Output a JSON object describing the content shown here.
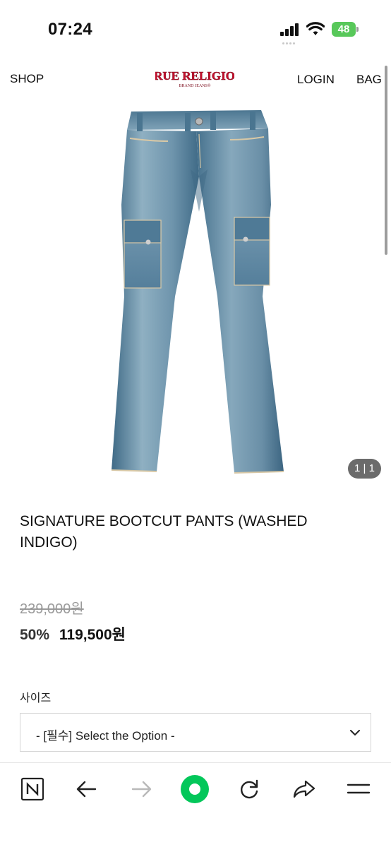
{
  "status_bar": {
    "time": "07:24",
    "battery_level": "48"
  },
  "header": {
    "shop_label": "SHOP",
    "logo_text": "TRUE RELIGION",
    "logo_subtext": "BRAND JEANS®",
    "login_label": "LOGIN",
    "bag_label": "BAG"
  },
  "product": {
    "image_counter": "1 | 1",
    "title": "SIGNATURE BOOTCUT PANTS (WASHED INDIGO)",
    "original_price": "239,000원",
    "discount": "50%",
    "sale_price": "119,500원"
  },
  "options": {
    "size_label": "사이즈",
    "select_text": "- [필수] Select the Option -"
  },
  "toolbar": {
    "icons": [
      "naver-n-icon",
      "back-arrow-icon",
      "forward-arrow-icon",
      "green-dot-icon",
      "reload-icon",
      "share-icon",
      "menu-icon"
    ]
  },
  "colors": {
    "brand_red": "#c8102e",
    "battery_green": "#58c85a",
    "toolbar_green": "#03c75a",
    "denim": "#5a86a3"
  }
}
